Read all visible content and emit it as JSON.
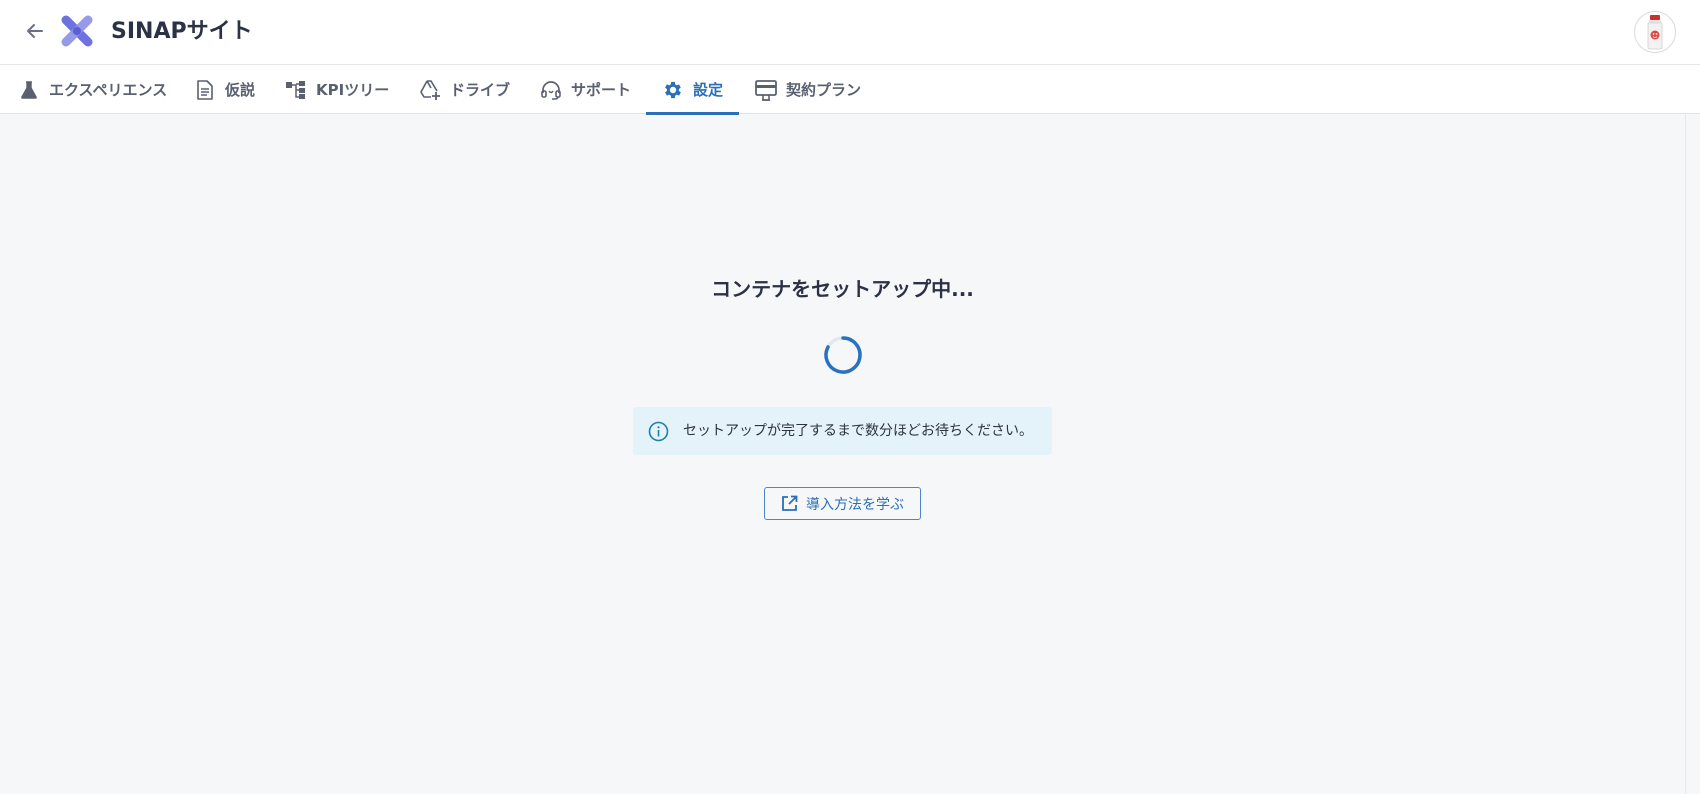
{
  "header": {
    "back_icon": "arrow-left-icon",
    "logo_icon": "x-logo-icon",
    "title": "SINAPサイト",
    "avatar_icon": "avatar-bottle-icon"
  },
  "nav": {
    "tabs": [
      {
        "label": "エクスペリエンス",
        "icon": "flask-icon",
        "active": false
      },
      {
        "label": "仮説",
        "icon": "document-icon",
        "active": false
      },
      {
        "label": "KPIツリー",
        "icon": "tree-icon",
        "active": false
      },
      {
        "label": "ドライブ",
        "icon": "drive-add-icon",
        "active": false
      },
      {
        "label": "サポート",
        "icon": "headset-icon",
        "active": false
      },
      {
        "label": "設定",
        "icon": "gear-icon",
        "active": true
      },
      {
        "label": "契約プラン",
        "icon": "billing-icon",
        "active": false
      }
    ]
  },
  "main": {
    "heading": "コンテナをセットアップ中...",
    "info_message": "セットアップが完了するまで数分ほどお待ちください。",
    "learn_button": "導入方法を学ぶ"
  },
  "colors": {
    "accent": "#2a6fb8",
    "logo": "#6d72e0",
    "info_bg": "#e3f3f9",
    "page_bg": "#f6f7f9"
  }
}
